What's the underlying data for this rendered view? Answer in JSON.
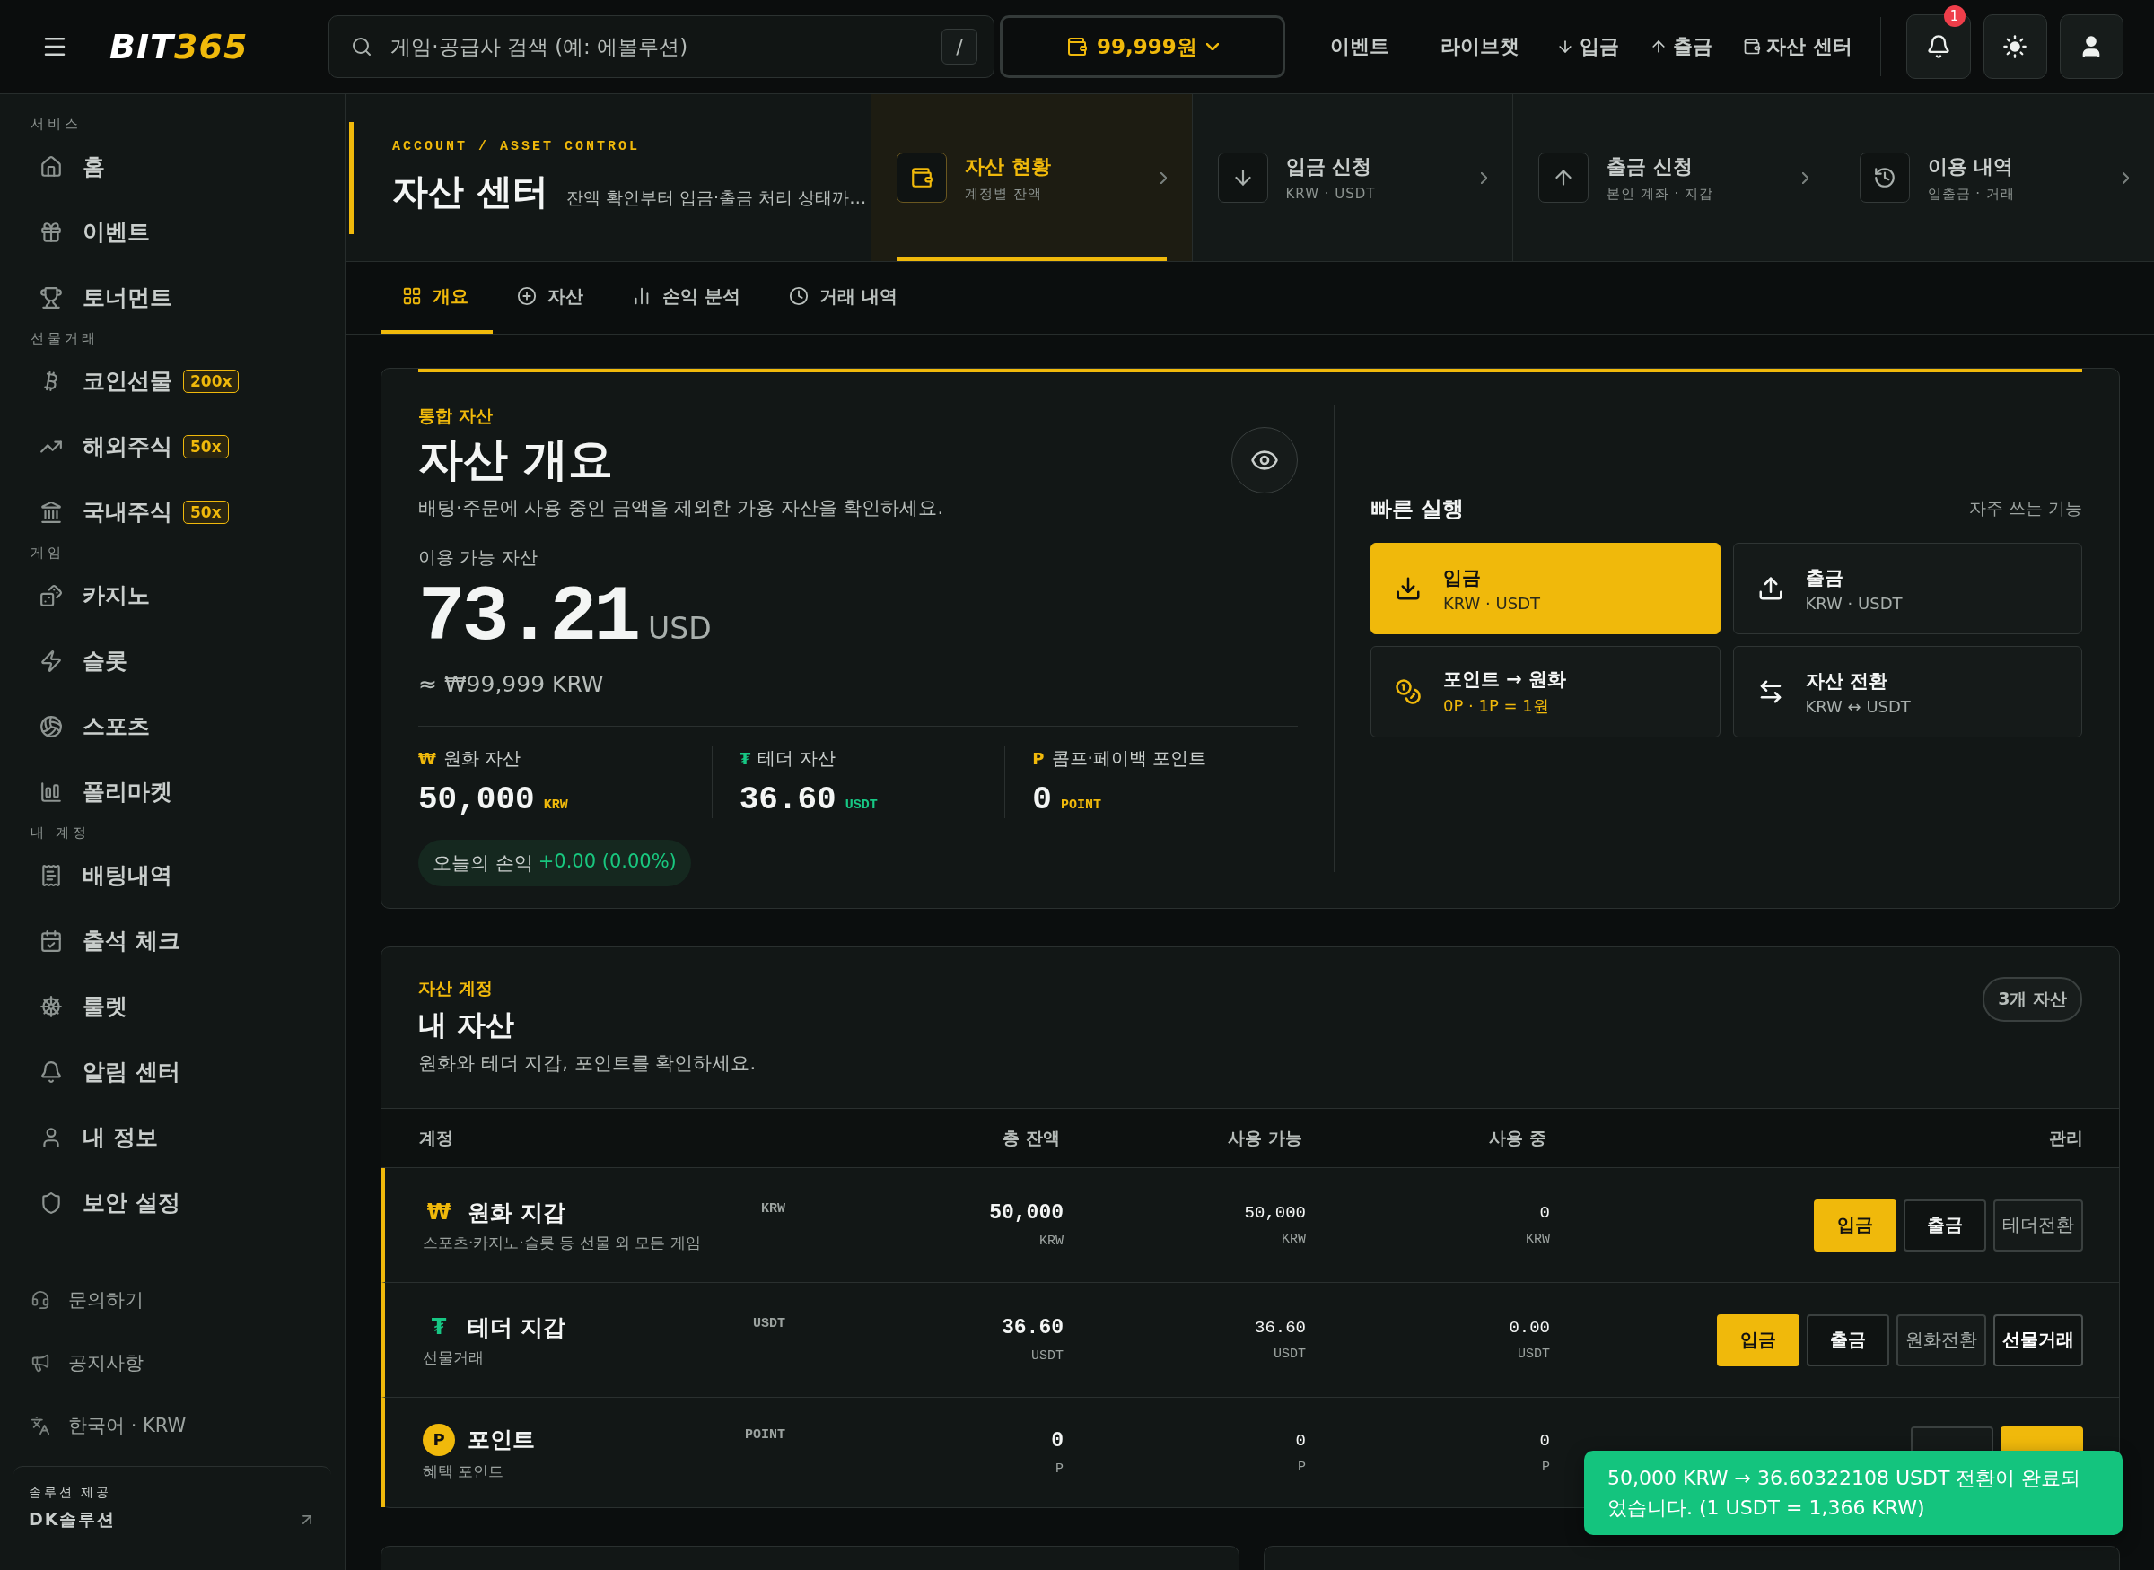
{
  "header": {
    "logo": {
      "main": "BIT",
      "accent": "365"
    },
    "search": {
      "placeholder": "게임·공급사 검색 (예: 에볼루션)",
      "shortcut": "/"
    },
    "balance": "99,999원",
    "nav": [
      {
        "label": "이벤트",
        "kind": "text"
      },
      {
        "label": "라이브챗",
        "kind": "text"
      },
      {
        "label": "입금",
        "kind": "down"
      },
      {
        "label": "출금",
        "kind": "up"
      },
      {
        "label": "자산 센터",
        "kind": "wallet"
      }
    ],
    "notifications": "1"
  },
  "sidebar": {
    "sections": [
      {
        "label": "서비스",
        "items": [
          {
            "label": "홈",
            "kind": "home"
          },
          {
            "label": "이벤트",
            "kind": "gift"
          },
          {
            "label": "토너먼트",
            "kind": "trophy"
          }
        ]
      },
      {
        "label": "선물거래",
        "items": [
          {
            "label": "코인선물",
            "kind": "bitcoin",
            "badge": "200x"
          },
          {
            "label": "해외주식",
            "kind": "trend",
            "badge": "50x"
          },
          {
            "label": "국내주식",
            "kind": "bank",
            "badge": "50x"
          }
        ]
      },
      {
        "label": "게임",
        "items": [
          {
            "label": "카지노",
            "kind": "dice"
          },
          {
            "label": "슬롯",
            "kind": "zap"
          },
          {
            "label": "스포츠",
            "kind": "ball"
          },
          {
            "label": "폴리마켓",
            "kind": "bars"
          }
        ]
      },
      {
        "label": "내 계정",
        "items": [
          {
            "label": "배팅내역",
            "kind": "receipt"
          },
          {
            "label": "출석 체크",
            "kind": "calendar"
          },
          {
            "label": "룰렛",
            "kind": "wheel"
          },
          {
            "label": "알림 센터",
            "kind": "bell"
          },
          {
            "label": "내 정보",
            "kind": "user"
          },
          {
            "label": "보안 설정",
            "kind": "shield"
          }
        ]
      }
    ],
    "links": [
      {
        "label": "문의하기",
        "kind": "headset"
      },
      {
        "label": "공지사항",
        "kind": "megaphone"
      },
      {
        "label": "한국어 · KRW",
        "kind": "language"
      }
    ],
    "footer": {
      "label": "솔루션 제공",
      "name": "DK솔루션"
    }
  },
  "page_header": {
    "eyebrow": "ACCOUNT / ASSET CONTROL",
    "title": "자산 센터",
    "subtitle": "잔액 확인부터 입금·출금 처리 상태까…",
    "shortcuts": [
      {
        "title": "자산 현황",
        "sub": "계정별 잔액",
        "kind": "wallet",
        "selected": true
      },
      {
        "title": "입금 신청",
        "sub": "KRW · USDT",
        "kind": "down",
        "selected": false
      },
      {
        "title": "출금 신청",
        "sub": "본인 계좌 · 지갑",
        "kind": "up",
        "selected": false
      },
      {
        "title": "이용 내역",
        "sub": "입출금 · 거래",
        "kind": "history",
        "selected": false
      }
    ]
  },
  "tabs": [
    {
      "label": "개요",
      "kind": "grid",
      "selected": true
    },
    {
      "label": "자산",
      "kind": "plus",
      "selected": false
    },
    {
      "label": "손익 분석",
      "kind": "chart",
      "selected": false
    },
    {
      "label": "거래 내역",
      "kind": "clock",
      "selected": false
    }
  ],
  "overview": {
    "eyebrow": "통합 자산",
    "title": "자산 개요",
    "description": "배팅·주문에 사용 중인 금액을 제외한 가용 자산을 확인하세요.",
    "available_label": "이용 가능 자산",
    "amount": "73.21",
    "unit": "USD",
    "approx": "≈ ₩99,999 KRW",
    "stats": [
      {
        "symbol": "₩",
        "label": "원화 자산",
        "value": "50,000",
        "unit": "KRW",
        "color": "#f0b90b"
      },
      {
        "symbol": "₮",
        "label": "테더 자산",
        "value": "36.60",
        "unit": "USDT",
        "color": "#17c784"
      },
      {
        "symbol": "P",
        "label": "콤프·페이백 포인트",
        "value": "0",
        "unit": "POINT",
        "color": "#f0b90b"
      }
    ],
    "pnl": {
      "label": "오늘의 손익",
      "value": "+0.00 (0.00%)"
    }
  },
  "quick_actions": {
    "title": "빠른 실행",
    "hint": "자주 쓰는 기능",
    "actions": [
      {
        "title": "입금",
        "sub": "KRW · USDT",
        "kind": "deposit",
        "primary": true
      },
      {
        "title": "출금",
        "sub": "KRW · USDT",
        "kind": "withdraw",
        "primary": false
      },
      {
        "title": "포인트 → 원화",
        "sub": "0P · 1P = 1원",
        "kind": "points",
        "primary": false
      },
      {
        "title": "자산 전환",
        "sub": "KRW ↔ USDT",
        "kind": "convert",
        "primary": false
      }
    ]
  },
  "assets": {
    "eyebrow": "자산 계정",
    "title": "내 자산",
    "description": "원화와 테더 지갑, 포인트를 확인하세요.",
    "count": "3개 자산",
    "columns": [
      "계정",
      "총 잔액",
      "사용 가능",
      "사용 중",
      "관리"
    ],
    "rows": [
      {
        "symbol": "₩",
        "kind": "glyph",
        "color": "#f0b90b",
        "name": "원화 지갑",
        "desc": "스포츠·카지노·슬롯 등 선물 외 모든 게임",
        "code": "KRW",
        "total": "50,000",
        "total_unit": "KRW",
        "available": "50,000",
        "available_unit": "KRW",
        "used": "0",
        "used_unit": "KRW",
        "buttons": [
          {
            "label": "입금",
            "kind": "primary"
          },
          {
            "label": "출금",
            "kind": "outline"
          },
          {
            "label": "테더전환",
            "kind": "muted"
          }
        ]
      },
      {
        "symbol": "₮",
        "kind": "glyph",
        "color": "#17c784",
        "name": "테더 지갑",
        "desc": "선물거래",
        "code": "USDT",
        "total": "36.60",
        "total_unit": "USDT",
        "available": "36.60",
        "available_unit": "USDT",
        "used": "0.00",
        "used_unit": "USDT",
        "buttons": [
          {
            "label": "입금",
            "kind": "primary"
          },
          {
            "label": "출금",
            "kind": "outline"
          },
          {
            "label": "원화전환",
            "kind": "muted"
          },
          {
            "label": "선물거래",
            "kind": "strong"
          }
        ]
      },
      {
        "symbol": "P",
        "kind": "coin",
        "color": "#f0b90b",
        "name": "포인트",
        "desc": "혜택 포인트",
        "code": "POINT",
        "total": "0",
        "total_unit": "P",
        "available": "0",
        "available_unit": "P",
        "used": "0",
        "used_unit": "P",
        "buttons": [
          {
            "kind": "muted"
          },
          {
            "kind": "primary"
          }
        ]
      }
    ]
  },
  "toast": {
    "message": "50,000 KRW → 36.60322108 USDT 전환이 완료되었습니다. (1 USDT = 1,366 KRW)"
  }
}
